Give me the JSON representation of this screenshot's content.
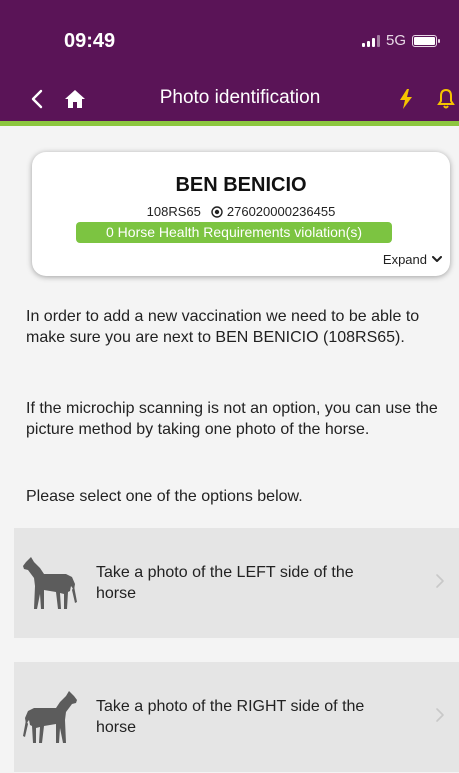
{
  "status_bar": {
    "time": "09:49",
    "network": "5G"
  },
  "nav": {
    "title": "Photo identification",
    "back_icon": "chevron-left-icon",
    "home_icon": "home-icon",
    "flash_icon": "lightning-icon",
    "bell_icon": "bell-icon",
    "brand_color": "#5a1457",
    "accent_color": "#8cc63f",
    "icon_accent_color": "#f5c400"
  },
  "horse": {
    "name": "BEN BENICIO",
    "registration": "108RS65",
    "microchip": "276020000236455",
    "health_badge": "0 Horse Health Requirements violation(s)",
    "health_badge_color": "#7cc441",
    "expand_label": "Expand"
  },
  "content": {
    "paragraph_1": "In order to add a new vaccination we need to be able to make sure you are next to BEN BENICIO (108RS65).",
    "paragraph_2": "If the microchip scanning is not an option, you can use the picture method by taking one photo of the horse.",
    "paragraph_3": "Please select one of the options below."
  },
  "options": [
    {
      "label": "Take a photo of the LEFT side of the horse",
      "icon": "horse-left-icon"
    },
    {
      "label": "Take a photo of the RIGHT side of the horse",
      "icon": "horse-right-icon"
    }
  ]
}
